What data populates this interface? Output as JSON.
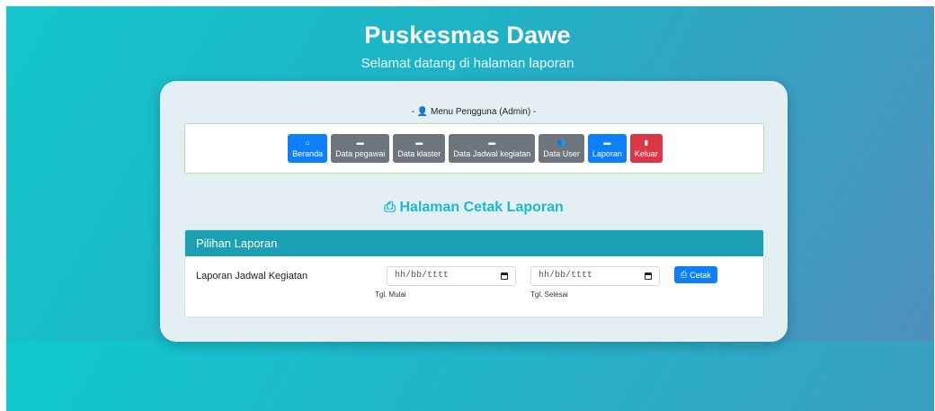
{
  "header": {
    "title": "Puskesmas Dawe",
    "subtitle": "Selamat datang di halaman laporan"
  },
  "menu": {
    "title": "- 👤 Menu Pengguna (Admin) -",
    "items": [
      {
        "label": "Beranda",
        "icon": "home-icon",
        "glyph": "⌂",
        "color": "#0d7ff8"
      },
      {
        "label": "Data pegawai",
        "icon": "id-card-icon",
        "glyph": "▬",
        "color": "#6d757d"
      },
      {
        "label": "Data klaster",
        "icon": "id-card-icon",
        "glyph": "▬",
        "color": "#6d757d"
      },
      {
        "label": "Data Jadwal kegiatan",
        "icon": "id-card-icon",
        "glyph": "▬",
        "color": "#6d757d"
      },
      {
        "label": "Data User",
        "icon": "users-icon",
        "glyph": "👥",
        "color": "#6d757d"
      },
      {
        "label": "Laporan",
        "icon": "id-card-icon",
        "glyph": "▬",
        "color": "#0d7ff8"
      },
      {
        "label": "Keluar",
        "icon": "bookmark-icon",
        "glyph": "▮",
        "color": "#dc3545"
      }
    ]
  },
  "page": {
    "heading_icon": "⎙",
    "heading": "Halaman Cetak Laporan"
  },
  "panel": {
    "header": "Pilihan Laporan",
    "row_label": "Laporan Jadwal Kegiatan",
    "start": {
      "placeholder": "hh/bb/tttt",
      "caption": "Tgl. Mulai"
    },
    "end": {
      "placeholder": "hh/bb/tttt",
      "caption": "Tgl. Selesai"
    },
    "print_icon": "⎙",
    "print_label": "Cetak"
  }
}
